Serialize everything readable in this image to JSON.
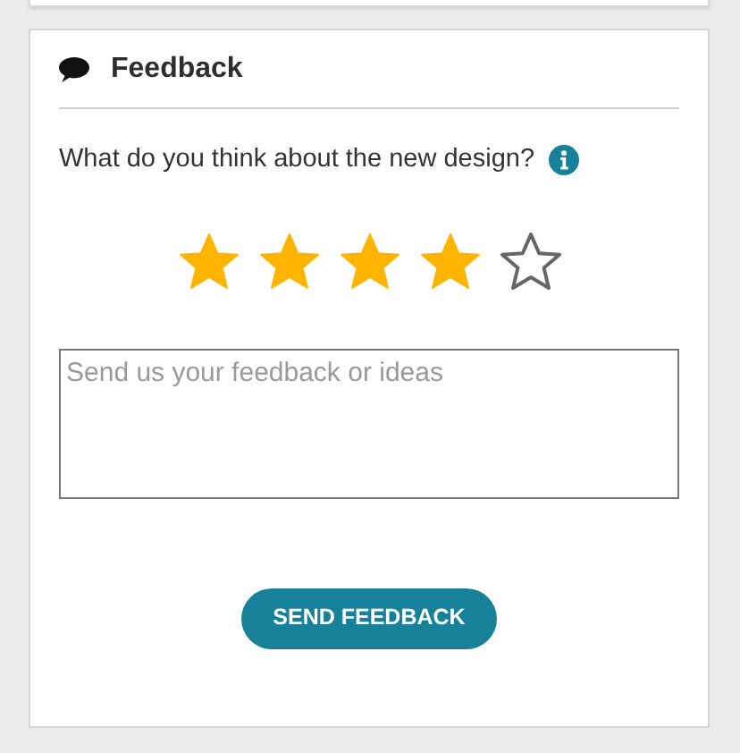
{
  "panel": {
    "title": "Feedback"
  },
  "question": "What do you think about the new design?",
  "rating": {
    "stars": 4
  },
  "feedback_field": {
    "placeholder": "Send us your feedback or ideas"
  },
  "submit_button": "SEND FEEDBACK"
}
